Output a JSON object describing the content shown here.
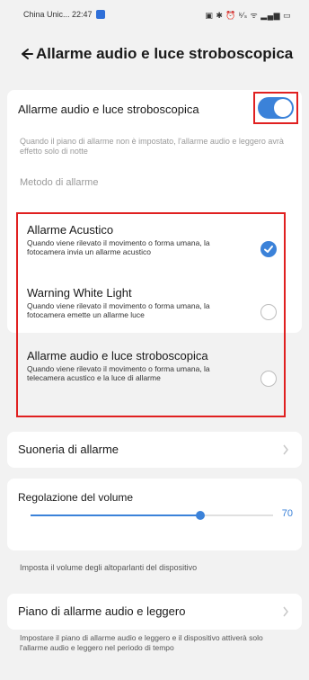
{
  "status_bar": {
    "carrier_time": "China Unic... 22:47",
    "icons_text": "▣ ✱ ⏰ ᵏ⁄ₛ ᯤ ▂▄▆ ▭"
  },
  "header": {
    "title": "Allarme audio e luce stroboscopica"
  },
  "main_toggle": {
    "label": "Allarme audio e luce stroboscopica",
    "enabled": true,
    "hint": "Quando il piano di allarme non è impostato, l'allarme audio e leggero avrà effetto solo di notte",
    "method_label": "Metodo di allarme"
  },
  "methods": [
    {
      "title": "Allarme Acustico",
      "desc": "Quando viene rilevato il movimento o forma umana, la fotocamera invia un allarme acustico",
      "selected": true
    },
    {
      "title": "Warning White Light",
      "desc": "Quando viene rilevato il movimento o forma umana, la fotocamera emette un allarme luce",
      "selected": false
    },
    {
      "title": "Allarme audio e luce stroboscopica",
      "desc": "Quando viene rilevato il movimento o forma umana, la telecamera acustico e la luce di allarme",
      "selected": false
    }
  ],
  "ringtone": {
    "label": "Suoneria di allarme"
  },
  "volume": {
    "label": "Regolazione del volume",
    "value": "70",
    "level": 0.7,
    "hint": "Imposta il volume degli altoparlanti del dispositivo"
  },
  "plan": {
    "label": "Piano di allarme audio e leggero",
    "hint": "Impostare il piano di allarme audio e leggero e il dispositivo attiverà solo l'allarme audio e leggero nel periodo di tempo"
  },
  "colors": {
    "accent": "#3b82d9",
    "highlight_border": "#e02020",
    "background": "#f2f2f2"
  }
}
